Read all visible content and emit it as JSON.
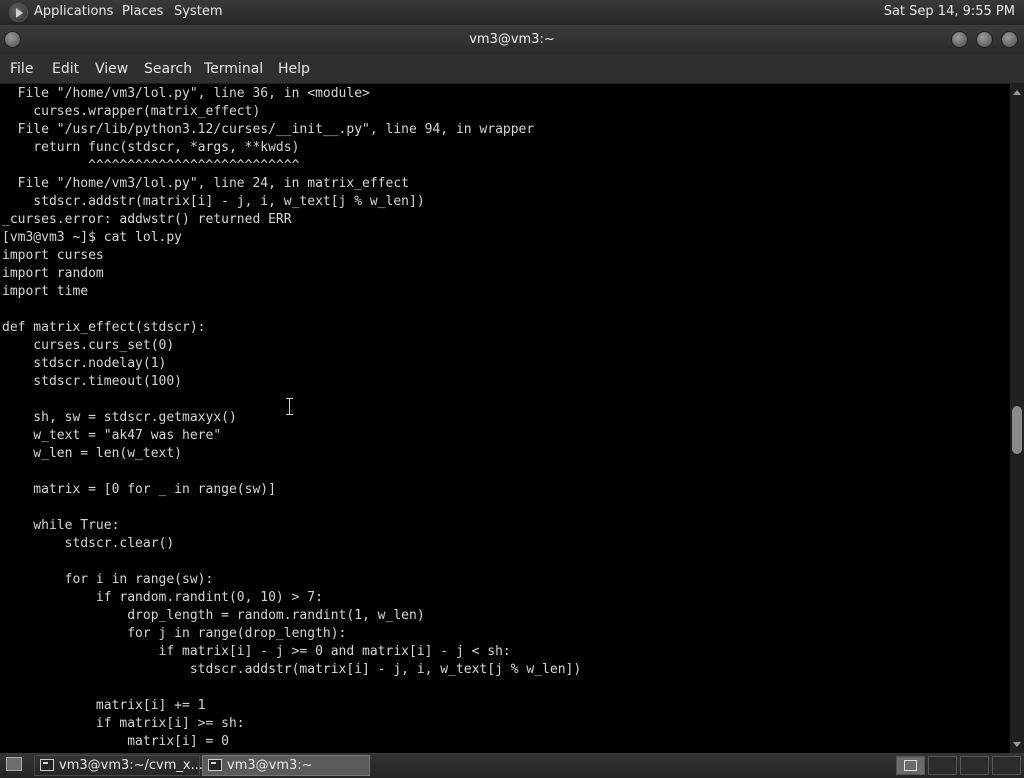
{
  "top_panel": {
    "menus": [
      "Applications",
      "Places",
      "System"
    ],
    "clock": "Sat Sep 14,  9:55 PM"
  },
  "window": {
    "title": "vm3@vm3:~"
  },
  "menubar": {
    "items": [
      "File",
      "Edit",
      "View",
      "Search",
      "Terminal",
      "Help"
    ]
  },
  "terminal": {
    "lines": [
      "  File \"/home/vm3/lol.py\", line 36, in <module>",
      "    curses.wrapper(matrix_effect)",
      "  File \"/usr/lib/python3.12/curses/__init__.py\", line 94, in wrapper",
      "    return func(stdscr, *args, **kwds)",
      "           ^^^^^^^^^^^^^^^^^^^^^^^^^^^",
      "  File \"/home/vm3/lol.py\", line 24, in matrix_effect",
      "    stdscr.addstr(matrix[i] - j, i, w_text[j % w_len])",
      "_curses.error: addwstr() returned ERR",
      "[vm3@vm3 ~]$ cat lol.py",
      "import curses",
      "import random",
      "import time",
      "",
      "def matrix_effect(stdscr):",
      "    curses.curs_set(0)",
      "    stdscr.nodelay(1)",
      "    stdscr.timeout(100)",
      "",
      "    sh, sw = stdscr.getmaxyx()",
      "    w_text = \"ak47 was here\"",
      "    w_len = len(w_text)",
      "",
      "    matrix = [0 for _ in range(sw)]",
      "",
      "    while True:",
      "        stdscr.clear()",
      "",
      "        for i in range(sw):",
      "            if random.randint(0, 10) > 7:",
      "                drop_length = random.randint(1, w_len)",
      "                for j in range(drop_length):",
      "                    if matrix[i] - j >= 0 and matrix[i] - j < sh:",
      "                        stdscr.addstr(matrix[i] - j, i, w_text[j % w_len])",
      "",
      "            matrix[i] += 1",
      "            if matrix[i] >= sh:",
      "                matrix[i] = 0"
    ]
  },
  "taskbar": {
    "tasks": [
      {
        "label": "vm3@vm3:~/cvm_x...",
        "active": false
      },
      {
        "label": "vm3@vm3:~",
        "active": true
      }
    ]
  }
}
